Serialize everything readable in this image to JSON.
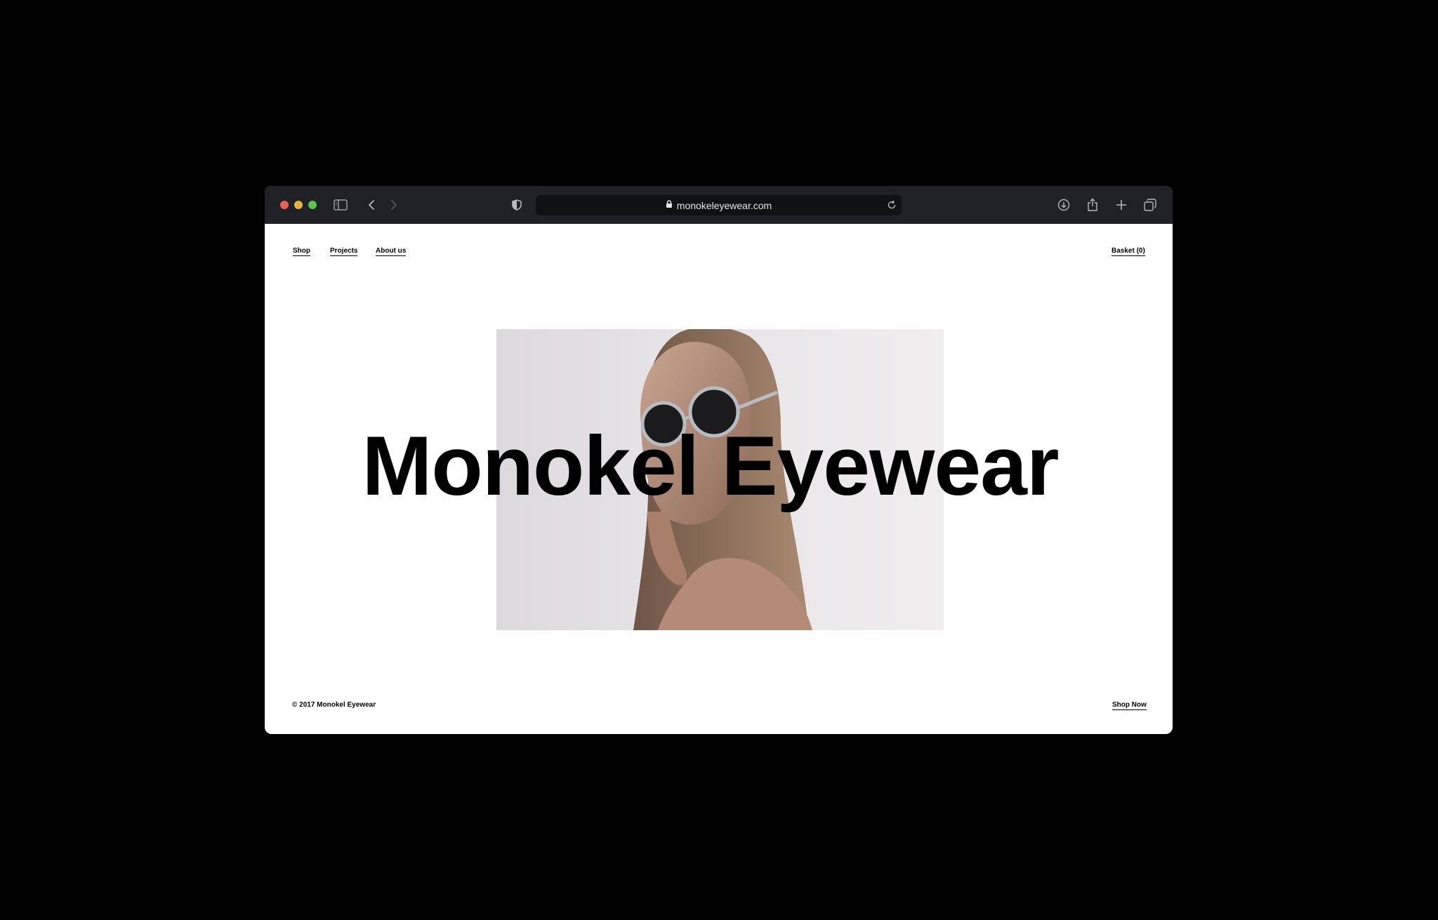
{
  "browser": {
    "url": "monokeleyewear.com"
  },
  "nav": {
    "shop": "Shop",
    "projects": "Projects",
    "about": "About us",
    "basket": "Basket (0)"
  },
  "hero": {
    "title": "Monokel Eyewear"
  },
  "footer": {
    "copyright": "© 2017 Monokel Eyewear",
    "shop_now": "Shop Now"
  }
}
